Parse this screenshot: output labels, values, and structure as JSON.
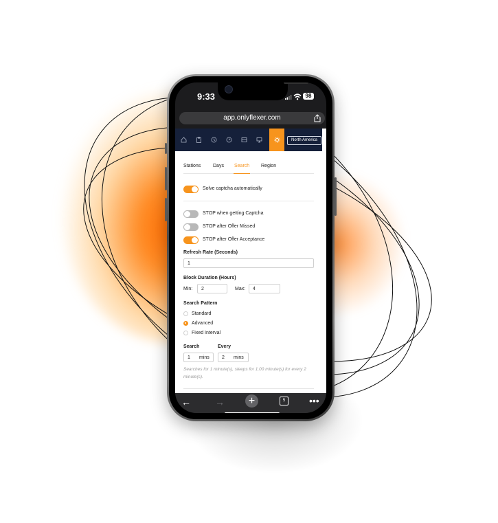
{
  "status_bar": {
    "time": "9:33",
    "battery": "98"
  },
  "browser": {
    "url": "app.onlyflexer.com",
    "tab_count": "5"
  },
  "app_nav": {
    "region_label": "North America",
    "accent_color": "#f7941d",
    "nav_bg": "#15203a"
  },
  "settings": {
    "tabs": [
      {
        "label": "Stations"
      },
      {
        "label": "Days"
      },
      {
        "label": "Search"
      },
      {
        "label": "Region"
      }
    ],
    "active_tab": "Search",
    "toggles": [
      {
        "label": "Solve captcha automatically",
        "on": true
      },
      {
        "label": "STOP when getting Captcha",
        "on": false
      },
      {
        "label": "STOP after Offer Missed",
        "on": false
      },
      {
        "label": "STOP after Offer Acceptance",
        "on": true
      }
    ],
    "refresh_rate": {
      "label": "Refresh Rate (Seconds)",
      "value": "1"
    },
    "block_duration": {
      "label": "Block Duration (Hours)",
      "min_label": "Min:",
      "min_value": "2",
      "max_label": "Max:",
      "max_value": "4"
    },
    "search_pattern": {
      "label": "Search Pattern",
      "options": [
        {
          "label": "Standard",
          "selected": false
        },
        {
          "label": "Advanced",
          "selected": true
        },
        {
          "label": "Fixed Interval",
          "selected": false
        }
      ]
    },
    "interval": {
      "search_label": "Search",
      "search_value": "1",
      "search_unit": "mins",
      "every_label": "Every",
      "every_value": "2",
      "every_unit": "mins"
    },
    "hint": "Searches for 1 minute(s), sleeps for 1.00 minute(s) for every 2 minute(s)."
  }
}
